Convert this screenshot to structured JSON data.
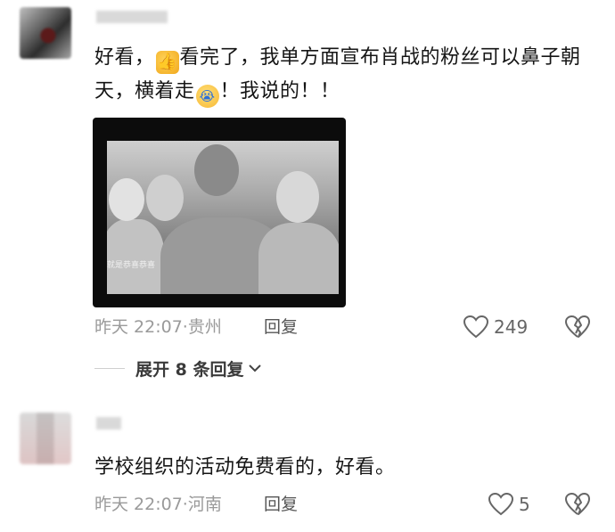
{
  "comments": [
    {
      "username": "",
      "text_before_thumb": "好看，",
      "text_after_thumb": "看完了，我单方面宣布肖战的粉丝可以鼻子朝天，横着走",
      "text_after_cry": "！我说的！！",
      "thumb_emoji": "👍",
      "cry_emoji": "😭",
      "image_caption": "就是恭喜恭喜",
      "timestamp": "昨天 22:07",
      "location": "贵州",
      "reply_label": "回复",
      "like_count": "249",
      "expand_label": "展开 8 条回复"
    },
    {
      "username": "",
      "text": "学校组织的活动免费看的，好看。",
      "timestamp": "昨天 22:07",
      "location": "河南",
      "reply_label": "回复",
      "like_count": "5"
    }
  ],
  "colors": {
    "meta_text": "#9a9a9a",
    "body_text": "#151515",
    "icon_gray": "#666666"
  }
}
